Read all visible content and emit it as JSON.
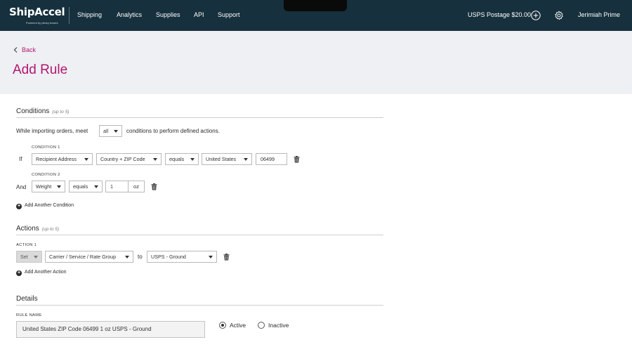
{
  "brand": {
    "name": "ShipAccel",
    "tagline": "Powered by pitney bowes"
  },
  "nav": {
    "items": [
      "Shipping",
      "Analytics",
      "Supplies",
      "API",
      "Support"
    ]
  },
  "account": {
    "postage": "USPS Postage $20.00",
    "user": "Jerimiah Prime"
  },
  "page": {
    "back_label": "Back",
    "title": "Add Rule"
  },
  "conditions": {
    "title": "Conditions",
    "hint": "(up to 5)",
    "intro_before": "While importing orders, meet",
    "match": "all",
    "intro_after": "conditions to perform defined actions.",
    "rows": [
      {
        "label": "CONDITION 1",
        "prefix": "If",
        "field": "Recipient Address",
        "subfield": "Country + ZIP Code",
        "operator": "equals",
        "value1": "United States",
        "value2": "06499"
      },
      {
        "label": "CONDITION 2",
        "prefix": "And",
        "field": "Weight",
        "operator": "equals",
        "value": "1",
        "unit": "oz"
      }
    ],
    "add_label": "Add Another Condition"
  },
  "actions": {
    "title": "Actions",
    "hint": "(up to 5)",
    "rows": [
      {
        "label": "ACTION 1",
        "verb": "Set",
        "target": "Carrier / Service / Rate Group",
        "connector": "to",
        "value": "USPS - Ground"
      }
    ],
    "add_label": "Add Another Action"
  },
  "details": {
    "title": "Details",
    "rule_name_label": "RULE NAME",
    "rule_name": "United States ZIP Code 06499 1 oz USPS - Ground",
    "status_options": [
      "Active",
      "Inactive"
    ],
    "status_selected": "Active"
  },
  "colors": {
    "nav_bg": "#16303d",
    "accent": "#b3166f",
    "band_bg": "#eef0f3"
  },
  "icons": {
    "back": "chevron-left-icon",
    "add_postage": "plus-circle-icon",
    "settings": "gear-icon",
    "delete": "trash-icon",
    "add": "plus-circle-filled-icon"
  }
}
